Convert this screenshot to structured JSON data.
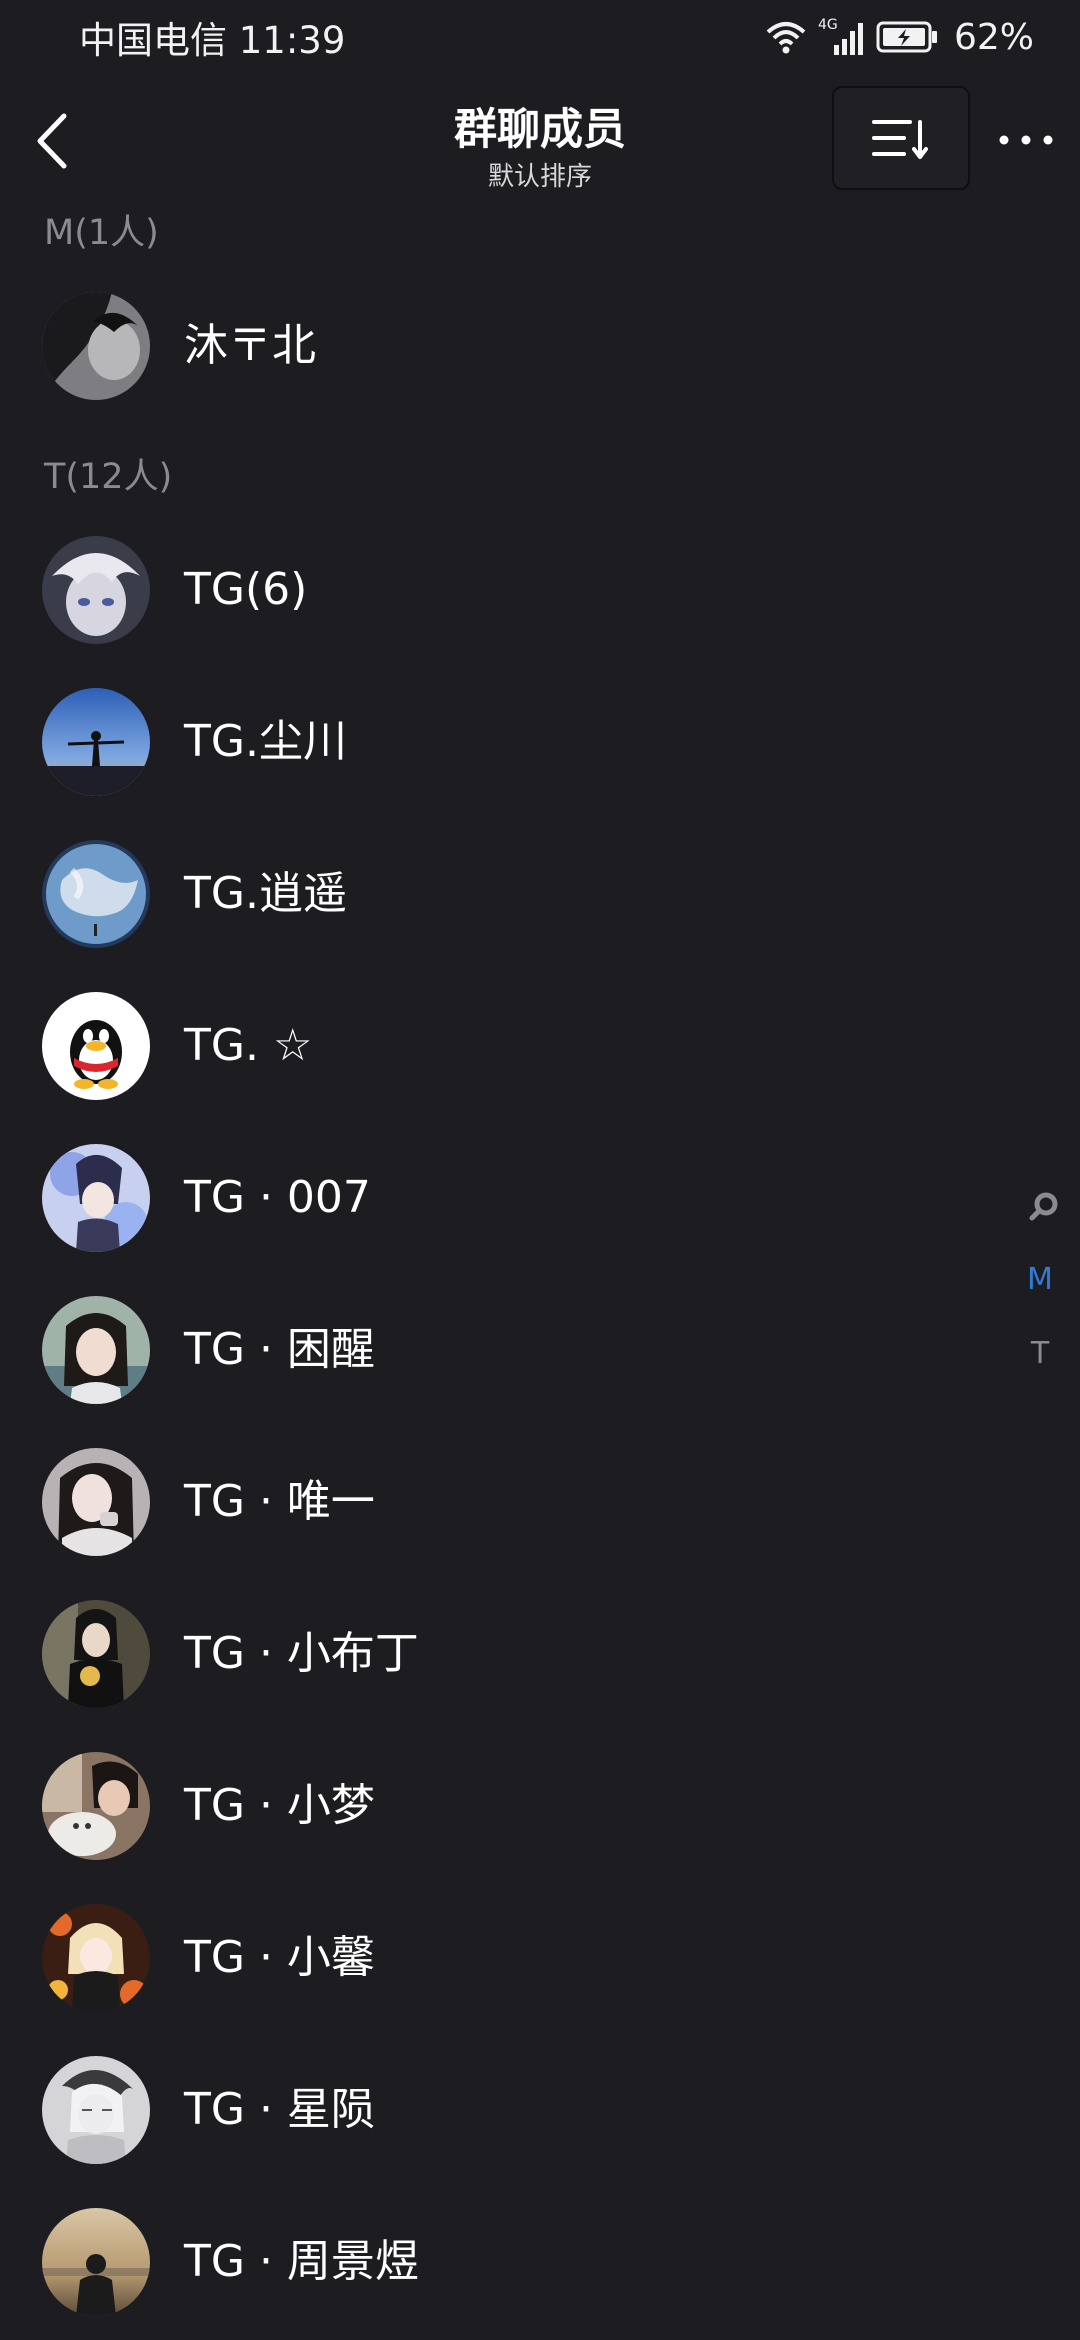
{
  "status_bar": {
    "carrier_time": "中国电信 11:39",
    "network": "4G",
    "battery": "62%"
  },
  "header": {
    "title": "群聊成员",
    "subtitle": "默认排序",
    "back_icon": "chevron-left-icon",
    "sort_icon": "sort-list-icon",
    "more_icon": "more-dots-icon"
  },
  "sections": [
    {
      "label": "M(1人)"
    },
    {
      "label": "T(12人)"
    }
  ],
  "members": [
    {
      "name": "沐〒北",
      "avatar_color": "#7a7a7e"
    },
    {
      "name": "TG(6)",
      "avatar_color": "#5b5d70"
    },
    {
      "name": "TG.尘川",
      "avatar_color": "#4c7fc4"
    },
    {
      "name": "TG.逍遥",
      "avatar_color": "#4a76a8"
    },
    {
      "name": "TG. ☆",
      "avatar_color": "#ffffff"
    },
    {
      "name": "TG · 007",
      "avatar_color": "#8f9fd8"
    },
    {
      "name": "TG · 困醒",
      "avatar_color": "#a9b3ae"
    },
    {
      "name": "TG · 唯一",
      "avatar_color": "#c9c2c4"
    },
    {
      "name": "TG · 小布丁",
      "avatar_color": "#6d6650"
    },
    {
      "name": "TG · 小梦",
      "avatar_color": "#a08a78"
    },
    {
      "name": "TG · 小馨",
      "avatar_color": "#c0703c"
    },
    {
      "name": "TG · 星陨",
      "avatar_color": "#cfcfd2"
    },
    {
      "name": "TG · 周景煜",
      "avatar_color": "#b3976e"
    }
  ],
  "index_bar": {
    "search_icon": "search-icon",
    "letters": [
      "M",
      "T"
    ],
    "active_color": "#2f7bd6",
    "inactive_color": "#8a8a90"
  }
}
